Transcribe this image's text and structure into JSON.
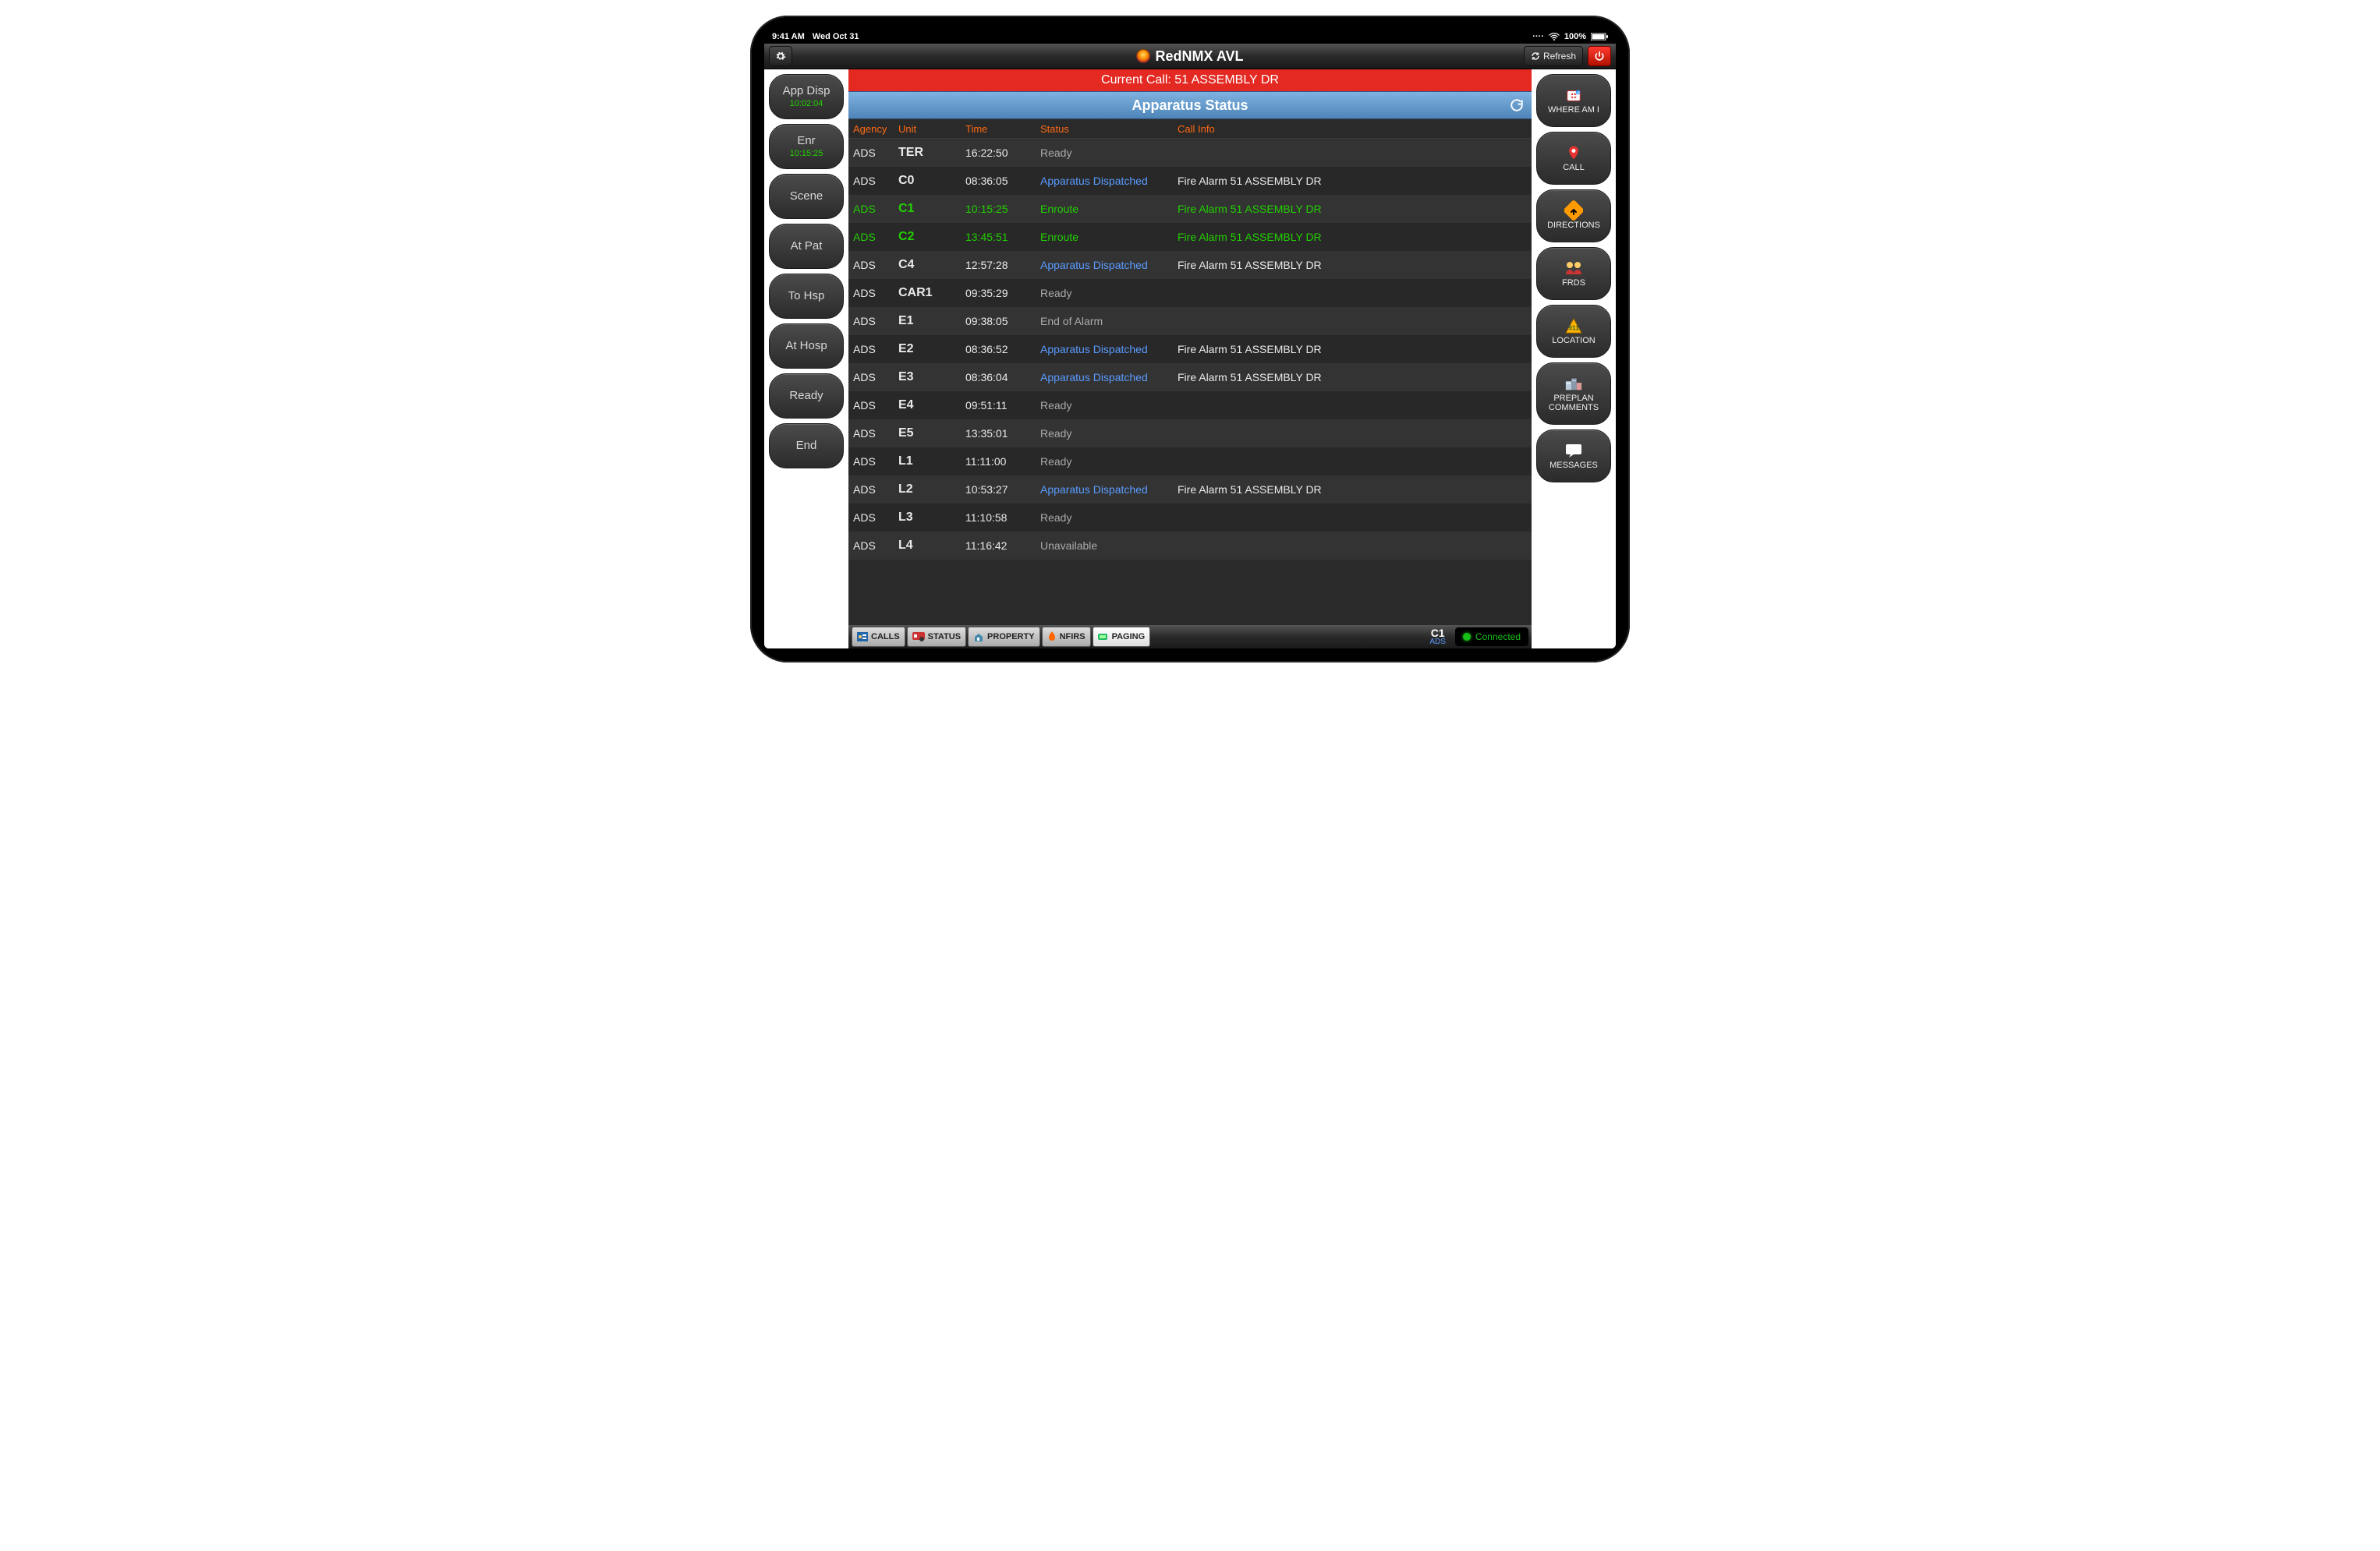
{
  "statusbar": {
    "time": "9:41 AM",
    "date": "Wed Oct 31",
    "battery": "100%"
  },
  "titlebar": {
    "title": "RedNMX AVL",
    "refresh": "Refresh"
  },
  "current_call": "Current Call: 51 ASSEMBLY DR",
  "panel_title": "Apparatus Status",
  "left_buttons": [
    {
      "label": "App Disp",
      "time": "10:02:04"
    },
    {
      "label": "Enr",
      "time": "10:15:25"
    },
    {
      "label": "Scene",
      "time": ""
    },
    {
      "label": "At Pat",
      "time": ""
    },
    {
      "label": "To Hsp",
      "time": ""
    },
    {
      "label": "At Hosp",
      "time": ""
    },
    {
      "label": "Ready",
      "time": ""
    },
    {
      "label": "End",
      "time": ""
    }
  ],
  "right_buttons": [
    {
      "label": "WHERE AM I"
    },
    {
      "label": "CALL"
    },
    {
      "label": "DIRECTIONS"
    },
    {
      "label": "FRDS"
    },
    {
      "label": "LOCATION"
    },
    {
      "label": "PREPLAN COMMENTS"
    },
    {
      "label": "MESSAGES"
    }
  ],
  "columns": {
    "agency": "Agency",
    "unit": "Unit",
    "time": "Time",
    "status": "Status",
    "call_info": "Call Info"
  },
  "rows": [
    {
      "agency": "ADS",
      "unit": "TER",
      "time": "16:22:50",
      "status": "Ready",
      "call": "",
      "style": "grey"
    },
    {
      "agency": "ADS",
      "unit": "C0",
      "time": "08:36:05",
      "status": "Apparatus Dispatched",
      "call": "Fire Alarm 51 ASSEMBLY DR",
      "style": "disp"
    },
    {
      "agency": "ADS",
      "unit": "C1",
      "time": "10:15:25",
      "status": "Enroute",
      "call": "Fire Alarm 51 ASSEMBLY DR",
      "style": "green"
    },
    {
      "agency": "ADS",
      "unit": "C2",
      "time": "13:45:51",
      "status": "Enroute",
      "call": "Fire Alarm 51 ASSEMBLY DR",
      "style": "green"
    },
    {
      "agency": "ADS",
      "unit": "C4",
      "time": "12:57:28",
      "status": "Apparatus Dispatched",
      "call": "Fire Alarm 51 ASSEMBLY DR",
      "style": "disp"
    },
    {
      "agency": "ADS",
      "unit": "CAR1",
      "time": "09:35:29",
      "status": "Ready",
      "call": "",
      "style": "grey"
    },
    {
      "agency": "ADS",
      "unit": "E1",
      "time": "09:38:05",
      "status": "End of Alarm",
      "call": "",
      "style": "grey"
    },
    {
      "agency": "ADS",
      "unit": "E2",
      "time": "08:36:52",
      "status": "Apparatus Dispatched",
      "call": "Fire Alarm 51 ASSEMBLY DR",
      "style": "disp"
    },
    {
      "agency": "ADS",
      "unit": "E3",
      "time": "08:36:04",
      "status": "Apparatus Dispatched",
      "call": "Fire Alarm 51 ASSEMBLY DR",
      "style": "disp"
    },
    {
      "agency": "ADS",
      "unit": "E4",
      "time": "09:51:11",
      "status": "Ready",
      "call": "",
      "style": "grey"
    },
    {
      "agency": "ADS",
      "unit": "E5",
      "time": "13:35:01",
      "status": "Ready",
      "call": "",
      "style": "grey"
    },
    {
      "agency": "ADS",
      "unit": "L1",
      "time": "11:11:00",
      "status": "Ready",
      "call": "",
      "style": "grey"
    },
    {
      "agency": "ADS",
      "unit": "L2",
      "time": "10:53:27",
      "status": "Apparatus Dispatched",
      "call": "Fire Alarm 51 ASSEMBLY DR",
      "style": "disp"
    },
    {
      "agency": "ADS",
      "unit": "L3",
      "time": "11:10:58",
      "status": "Ready",
      "call": "",
      "style": "grey"
    },
    {
      "agency": "ADS",
      "unit": "L4",
      "time": "11:16:42",
      "status": "Unavailable",
      "call": "",
      "style": "grey"
    }
  ],
  "bottom_tabs": [
    {
      "label": "CALLS"
    },
    {
      "label": "STATUS"
    },
    {
      "label": "PROPERTY"
    },
    {
      "label": "NFIRS"
    },
    {
      "label": "PAGING"
    }
  ],
  "bottom_unit": {
    "unit": "C1",
    "agency": "ADS"
  },
  "connection": "Connected"
}
